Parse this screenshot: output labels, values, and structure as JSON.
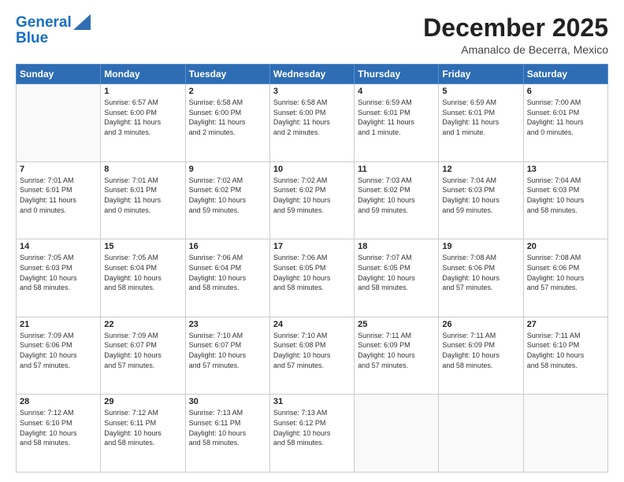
{
  "header": {
    "logo_line1": "General",
    "logo_line2": "Blue",
    "month": "December 2025",
    "location": "Amanalco de Becerra, Mexico"
  },
  "weekdays": [
    "Sunday",
    "Monday",
    "Tuesday",
    "Wednesday",
    "Thursday",
    "Friday",
    "Saturday"
  ],
  "weeks": [
    [
      {
        "day": "",
        "info": ""
      },
      {
        "day": "1",
        "info": "Sunrise: 6:57 AM\nSunset: 6:00 PM\nDaylight: 11 hours\nand 3 minutes."
      },
      {
        "day": "2",
        "info": "Sunrise: 6:58 AM\nSunset: 6:00 PM\nDaylight: 11 hours\nand 2 minutes."
      },
      {
        "day": "3",
        "info": "Sunrise: 6:58 AM\nSunset: 6:00 PM\nDaylight: 11 hours\nand 2 minutes."
      },
      {
        "day": "4",
        "info": "Sunrise: 6:59 AM\nSunset: 6:01 PM\nDaylight: 11 hours\nand 1 minute."
      },
      {
        "day": "5",
        "info": "Sunrise: 6:59 AM\nSunset: 6:01 PM\nDaylight: 11 hours\nand 1 minute."
      },
      {
        "day": "6",
        "info": "Sunrise: 7:00 AM\nSunset: 6:01 PM\nDaylight: 11 hours\nand 0 minutes."
      }
    ],
    [
      {
        "day": "7",
        "info": "Sunrise: 7:01 AM\nSunset: 6:01 PM\nDaylight: 11 hours\nand 0 minutes."
      },
      {
        "day": "8",
        "info": "Sunrise: 7:01 AM\nSunset: 6:01 PM\nDaylight: 11 hours\nand 0 minutes."
      },
      {
        "day": "9",
        "info": "Sunrise: 7:02 AM\nSunset: 6:02 PM\nDaylight: 10 hours\nand 59 minutes."
      },
      {
        "day": "10",
        "info": "Sunrise: 7:02 AM\nSunset: 6:02 PM\nDaylight: 10 hours\nand 59 minutes."
      },
      {
        "day": "11",
        "info": "Sunrise: 7:03 AM\nSunset: 6:02 PM\nDaylight: 10 hours\nand 59 minutes."
      },
      {
        "day": "12",
        "info": "Sunrise: 7:04 AM\nSunset: 6:03 PM\nDaylight: 10 hours\nand 59 minutes."
      },
      {
        "day": "13",
        "info": "Sunrise: 7:04 AM\nSunset: 6:03 PM\nDaylight: 10 hours\nand 58 minutes."
      }
    ],
    [
      {
        "day": "14",
        "info": "Sunrise: 7:05 AM\nSunset: 6:03 PM\nDaylight: 10 hours\nand 58 minutes."
      },
      {
        "day": "15",
        "info": "Sunrise: 7:05 AM\nSunset: 6:04 PM\nDaylight: 10 hours\nand 58 minutes."
      },
      {
        "day": "16",
        "info": "Sunrise: 7:06 AM\nSunset: 6:04 PM\nDaylight: 10 hours\nand 58 minutes."
      },
      {
        "day": "17",
        "info": "Sunrise: 7:06 AM\nSunset: 6:05 PM\nDaylight: 10 hours\nand 58 minutes."
      },
      {
        "day": "18",
        "info": "Sunrise: 7:07 AM\nSunset: 6:05 PM\nDaylight: 10 hours\nand 58 minutes."
      },
      {
        "day": "19",
        "info": "Sunrise: 7:08 AM\nSunset: 6:06 PM\nDaylight: 10 hours\nand 57 minutes."
      },
      {
        "day": "20",
        "info": "Sunrise: 7:08 AM\nSunset: 6:06 PM\nDaylight: 10 hours\nand 57 minutes."
      }
    ],
    [
      {
        "day": "21",
        "info": "Sunrise: 7:09 AM\nSunset: 6:06 PM\nDaylight: 10 hours\nand 57 minutes."
      },
      {
        "day": "22",
        "info": "Sunrise: 7:09 AM\nSunset: 6:07 PM\nDaylight: 10 hours\nand 57 minutes."
      },
      {
        "day": "23",
        "info": "Sunrise: 7:10 AM\nSunset: 6:07 PM\nDaylight: 10 hours\nand 57 minutes."
      },
      {
        "day": "24",
        "info": "Sunrise: 7:10 AM\nSunset: 6:08 PM\nDaylight: 10 hours\nand 57 minutes."
      },
      {
        "day": "25",
        "info": "Sunrise: 7:11 AM\nSunset: 6:09 PM\nDaylight: 10 hours\nand 57 minutes."
      },
      {
        "day": "26",
        "info": "Sunrise: 7:11 AM\nSunset: 6:09 PM\nDaylight: 10 hours\nand 58 minutes."
      },
      {
        "day": "27",
        "info": "Sunrise: 7:11 AM\nSunset: 6:10 PM\nDaylight: 10 hours\nand 58 minutes."
      }
    ],
    [
      {
        "day": "28",
        "info": "Sunrise: 7:12 AM\nSunset: 6:10 PM\nDaylight: 10 hours\nand 58 minutes."
      },
      {
        "day": "29",
        "info": "Sunrise: 7:12 AM\nSunset: 6:11 PM\nDaylight: 10 hours\nand 58 minutes."
      },
      {
        "day": "30",
        "info": "Sunrise: 7:13 AM\nSunset: 6:11 PM\nDaylight: 10 hours\nand 58 minutes."
      },
      {
        "day": "31",
        "info": "Sunrise: 7:13 AM\nSunset: 6:12 PM\nDaylight: 10 hours\nand 58 minutes."
      },
      {
        "day": "",
        "info": ""
      },
      {
        "day": "",
        "info": ""
      },
      {
        "day": "",
        "info": ""
      }
    ]
  ]
}
